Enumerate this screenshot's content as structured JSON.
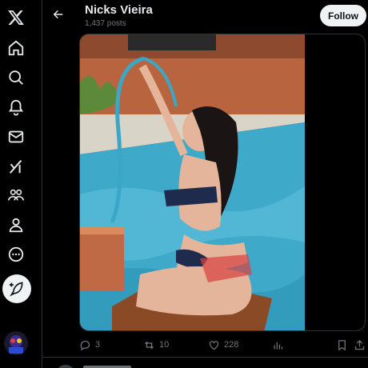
{
  "profile": {
    "name": "Nicks Vieira",
    "posts_count": "1,437 posts",
    "follow_label": "Follow"
  },
  "nav": {
    "items": [
      "x-logo-icon",
      "home-icon",
      "explore-icon",
      "notifications-icon",
      "messages-icon",
      "grok-icon",
      "communities-icon",
      "profile-icon",
      "more-icon"
    ]
  },
  "post": {
    "replies": "3",
    "reposts": "10",
    "likes": "228"
  },
  "colors": {
    "background": "#000000",
    "border": "#2f3336",
    "muted": "#71767b",
    "text": "#e7e9ea",
    "follow_bg": "#eff3f4"
  }
}
